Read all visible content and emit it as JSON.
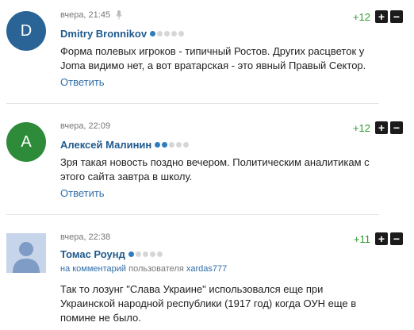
{
  "comments": [
    {
      "avatar_letter": "D",
      "avatar_color": "#2a6496",
      "time": "вчера, 21:45",
      "author": "Dmitry Bronnikov",
      "rating_dots_filled": 1,
      "votes": "+12",
      "plus": "+",
      "minus": "−",
      "text": "Форма полевых игроков - типичный Ростов. Других расцветок у Joma видимо нет, а вот вратарская - это явный Правый Сектор.",
      "reply": "Ответить"
    },
    {
      "avatar_letter": "А",
      "avatar_color": "#2e8b3a",
      "time": "вчера, 22:09",
      "author": "Алексей Малинин",
      "rating_dots_filled": 2,
      "votes": "+12",
      "plus": "+",
      "minus": "−",
      "text": "Зря такая новость поздно вечером. Политическим аналитикам с этого сайта завтра в школу.",
      "reply": "Ответить"
    },
    {
      "avatar_letter": "",
      "avatar_color": "#c7d5ea",
      "time": "вчера, 22:38",
      "author": "Томас Роунд",
      "rating_dots_filled": 1,
      "votes": "+11",
      "plus": "+",
      "minus": "−",
      "reply_to_prefix": "на комментарий",
      "reply_to_middle": "пользователя",
      "reply_to_user": "xardas777",
      "text": "Так то лозунг \"Слава Украине\" использовался еще при Украинской народной республики (1917 год) когда ОУН еще в помине не было."
    }
  ]
}
